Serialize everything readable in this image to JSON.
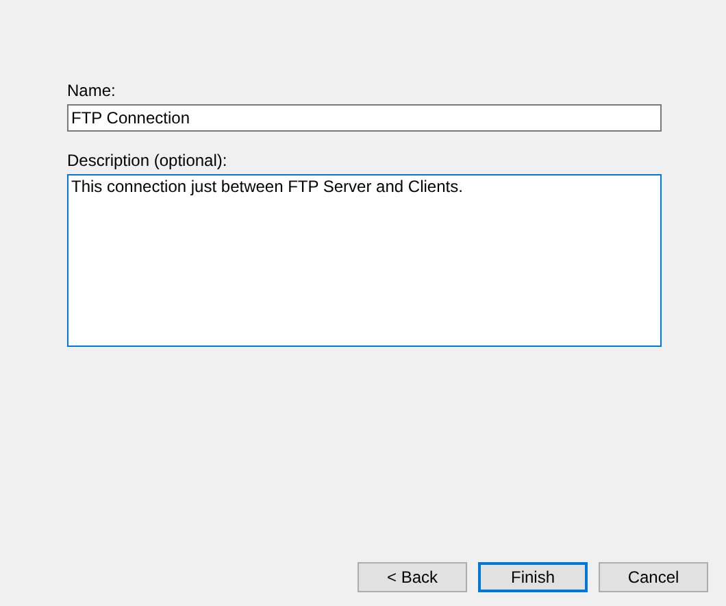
{
  "fields": [
    {
      "kind": "line",
      "label": "Name:",
      "value": "FTP Connection",
      "focused": false
    },
    {
      "kind": "multiline",
      "label": "Description (optional):",
      "value": "This connection just between FTP Server and Clients.",
      "focused": true
    }
  ],
  "buttons": [
    {
      "label": "< Back",
      "default": false
    },
    {
      "label": "Finish",
      "default": true
    },
    {
      "label": "Cancel",
      "default": false
    }
  ]
}
